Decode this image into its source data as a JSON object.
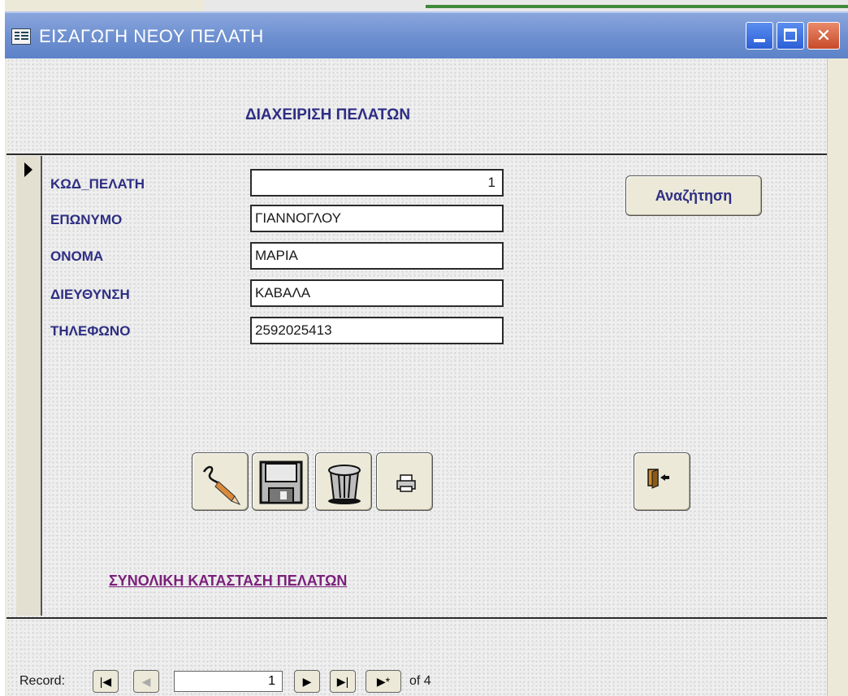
{
  "window": {
    "title": "ΕΙΣΑΓΩΓΗ ΝΕΟΥ ΠΕΛΑΤΗ",
    "controls": {
      "minimize": "_",
      "maximize": "□",
      "close": "✕"
    }
  },
  "header": {
    "title": "ΔΙΑΧΕΙΡΙΣΗ ΠΕΛΑΤΩΝ"
  },
  "fields": [
    {
      "label": "ΚΩΔ_ΠΕΛΑΤΗ",
      "value": "1"
    },
    {
      "label": "ΕΠΩΝΥΜΟ",
      "value": "ΓΙΑΝΝΟΓΛΟΥ"
    },
    {
      "label": "ΟΝΟΜΑ",
      "value": "ΜΑΡΙΑ"
    },
    {
      "label": "ΔΙΕΥΘΥΝΣΗ",
      "value": "ΚΑΒΑΛΑ"
    },
    {
      "label": "ΤΗΛΕΦΩΝΟ",
      "value": "2592025413"
    }
  ],
  "buttons": {
    "search": "Αναζήτηση",
    "icons": [
      "edit-pencil-icon",
      "save-floppy-icon",
      "delete-trash-icon",
      "print-icon",
      "exit-door-icon"
    ]
  },
  "report_link": "ΣΥΝΟΛΙΚΗ ΚΑΤΑΣΤΑΣΗ ΠΕΛΑΤΩΝ",
  "record_nav": {
    "label": "Record:",
    "current": "1",
    "total_text": "of 4",
    "buttons": {
      "first": "|◀",
      "prev": "◀",
      "next": "▶",
      "last": "▶|",
      "new": "▶*"
    }
  }
}
